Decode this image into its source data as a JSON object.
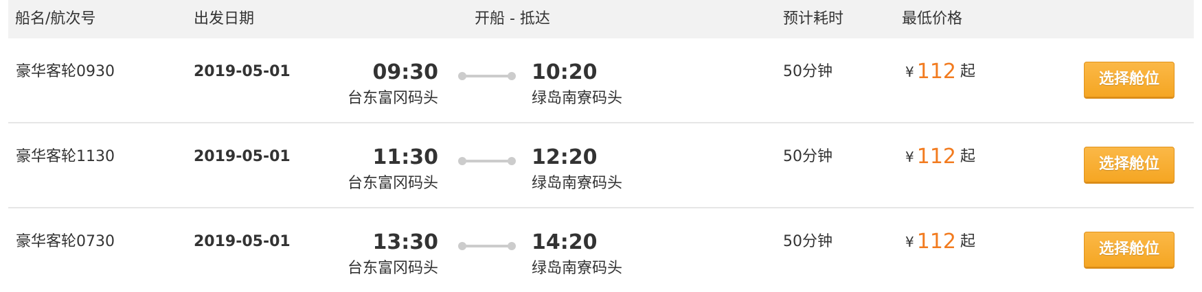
{
  "header": {
    "ship_name": "船名/航次号",
    "date": "出发日期",
    "route": "开船 - 抵达",
    "duration": "预计耗时",
    "price": "最低价格"
  },
  "rows": [
    {
      "ship": "豪华客轮0930",
      "date": "2019-05-01",
      "depart_time": "09:30",
      "depart_port": "台东富冈码头",
      "arrive_time": "10:20",
      "arrive_port": "绿岛南寮码头",
      "duration": "50分钟",
      "currency": "¥",
      "price": "112",
      "price_suffix": "起",
      "button": "选择舱位"
    },
    {
      "ship": "豪华客轮1130",
      "date": "2019-05-01",
      "depart_time": "11:30",
      "depart_port": "台东富冈码头",
      "arrive_time": "12:20",
      "arrive_port": "绿岛南寮码头",
      "duration": "50分钟",
      "currency": "¥",
      "price": "112",
      "price_suffix": "起",
      "button": "选择舱位"
    },
    {
      "ship": "豪华客轮0730",
      "date": "2019-05-01",
      "depart_time": "13:30",
      "depart_port": "台东富冈码头",
      "arrive_time": "14:20",
      "arrive_port": "绿岛南寮码头",
      "duration": "50分钟",
      "currency": "¥",
      "price": "112",
      "price_suffix": "起",
      "button": "选择舱位"
    }
  ],
  "colors": {
    "accent_price": "#f27b1f",
    "button_bg": "#f5a623",
    "header_bg": "#f2f2f2"
  }
}
